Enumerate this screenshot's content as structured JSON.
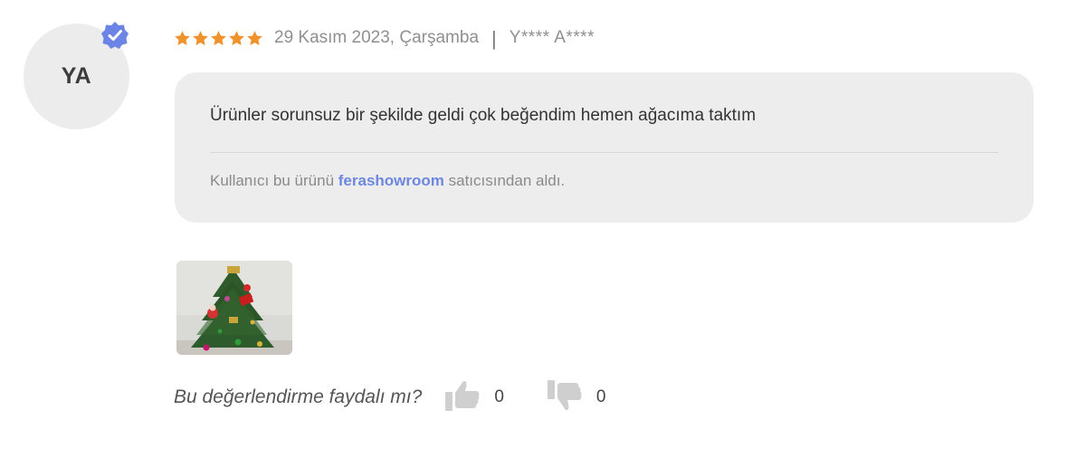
{
  "review": {
    "avatar_initials": "YA",
    "verified_icon": "verified-badge-icon",
    "rating": 5,
    "date": "29 Kasım 2023, Çarşamba",
    "separator": "|",
    "author": "Y**** A****",
    "comment": "Ürünler sorunsuz bir şekilde geldi çok beğendim hemen ağacıma taktım",
    "seller": {
      "prefix": "Kullanıcı bu ürünü ",
      "name": "ferashowroom",
      "suffix": " satıcısından aldı."
    },
    "photo_icon": "christmas-tree-photo"
  },
  "helpful": {
    "question": "Bu değerlendirme faydalı mı?",
    "likes": "0",
    "dislikes": "0"
  },
  "colors": {
    "star": "#f0922b",
    "verified": "#6b84e5",
    "seller_link": "#6d87e0",
    "bubble_bg": "#ededed"
  }
}
